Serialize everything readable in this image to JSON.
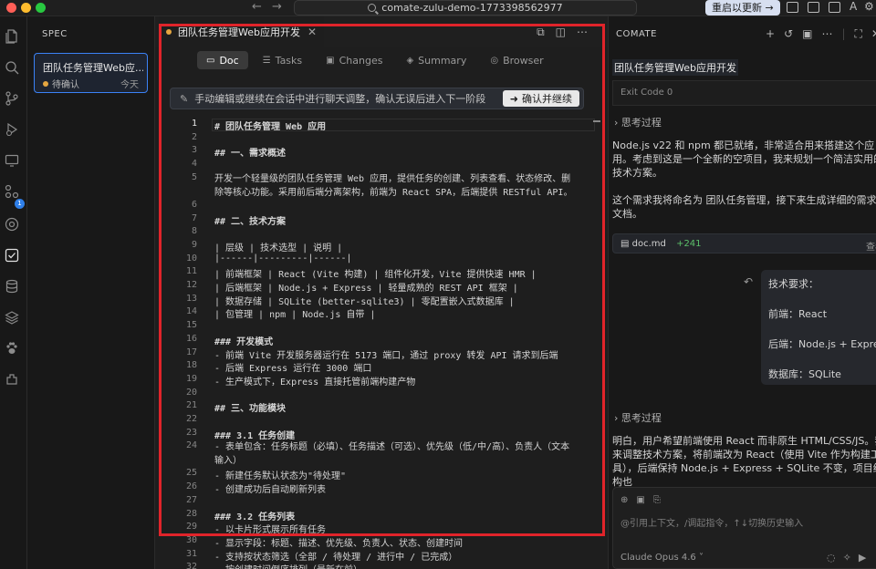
{
  "titlebar": {
    "search_text": "comate-zulu-demo-1773398562977",
    "update_label": "重启以更新 →",
    "back_arrow": "←",
    "forward_arrow": "→",
    "colors": {
      "close": "#ff5f57",
      "minimize": "#febc2e",
      "zoom": "#28c840"
    },
    "right_icons": [
      "layout-sidebar-icon",
      "layout-panel-icon",
      "layout-right-icon",
      "text-size-icon",
      "settings-icon"
    ]
  },
  "activitybar": {
    "icons": [
      "explorer-icon",
      "search-icon",
      "source-control-icon",
      "run-debug-icon",
      "remote-icon",
      "extensions-icon",
      "browser-icon",
      "spec-icon",
      "database-icon",
      "layers-icon",
      "paw-icon",
      "plugin-icon"
    ],
    "badge": "1"
  },
  "spec": {
    "title": "SPEC",
    "card": {
      "title": "团队任务管理Web应...",
      "status": "待确认",
      "time": "今天"
    }
  },
  "editor": {
    "tab_title": "团队任务管理Web应用开发",
    "tab_close": "✕",
    "view_tabs": [
      {
        "label": "Doc",
        "icon": "doc-icon",
        "glyph": "▭"
      },
      {
        "label": "Tasks",
        "icon": "tasks-icon",
        "glyph": "☰"
      },
      {
        "label": "Changes",
        "icon": "changes-icon",
        "glyph": "▣"
      },
      {
        "label": "Summary",
        "icon": "summary-icon",
        "glyph": "◈"
      },
      {
        "label": "Browser",
        "icon": "browser-icon",
        "glyph": "◎"
      }
    ],
    "notice": "手动编辑或继续在会话中进行聊天调整，确认无误后进入下一阶段",
    "confirm_label": "确认并继续",
    "lines": [
      {
        "n": "1",
        "t": "# 团队任务管理 Web 应用"
      },
      {
        "n": "2",
        "t": ""
      },
      {
        "n": "3",
        "t": "## 一、需求概述"
      },
      {
        "n": "4",
        "t": ""
      },
      {
        "n": "5",
        "t": "开发一个轻量级的团队任务管理 Web 应用，提供任务的创建、列表查看、状态修改、删除等核心功能。采用前后端分离架构，前端为 React SPA，后端提供 RESTful API。",
        "wrap": true
      },
      {
        "n": "6",
        "t": ""
      },
      {
        "n": "7",
        "t": "## 二、技术方案"
      },
      {
        "n": "8",
        "t": ""
      },
      {
        "n": "9",
        "t": "| 层级 | 技术选型 | 说明 |"
      },
      {
        "n": "10",
        "t": "|------|---------|------|"
      },
      {
        "n": "11",
        "t": "| 前端框架 | React (Vite 构建) | 组件化开发，Vite 提供快速 HMR |"
      },
      {
        "n": "12",
        "t": "| 后端框架 | Node.js + Express | 轻量成熟的 REST API 框架 |"
      },
      {
        "n": "13",
        "t": "| 数据存储 | SQLite (better-sqlite3) | 零配置嵌入式数据库 |"
      },
      {
        "n": "14",
        "t": "| 包管理 | npm | Node.js 自带 |"
      },
      {
        "n": "15",
        "t": ""
      },
      {
        "n": "16",
        "t": "### 开发模式"
      },
      {
        "n": "17",
        "t": "- 前端 Vite 开发服务器运行在 5173 端口，通过 proxy 转发 API 请求到后端"
      },
      {
        "n": "18",
        "t": "- 后端 Express 运行在 3000 端口"
      },
      {
        "n": "19",
        "t": "- 生产模式下，Express 直接托管前端构建产物"
      },
      {
        "n": "20",
        "t": ""
      },
      {
        "n": "21",
        "t": "## 三、功能模块"
      },
      {
        "n": "22",
        "t": ""
      },
      {
        "n": "23",
        "t": "### 3.1 任务创建"
      },
      {
        "n": "24",
        "t": "- 表单包含：任务标题（必填）、任务描述（可选）、优先级（低/中/高）、负责人（文本输入）",
        "wrap": true
      },
      {
        "n": "25",
        "t": "- 新建任务默认状态为\"待处理\""
      },
      {
        "n": "26",
        "t": "- 创建成功后自动刷新列表"
      },
      {
        "n": "27",
        "t": ""
      },
      {
        "n": "28",
        "t": "### 3.2 任务列表"
      },
      {
        "n": "29",
        "t": "- 以卡片形式展示所有任务"
      },
      {
        "n": "30",
        "t": "- 显示字段：标题、描述、优先级、负责人、状态、创建时间"
      },
      {
        "n": "31",
        "t": "- 支持按状态筛选（全部 / 待处理 / 进行中 / 已完成）"
      },
      {
        "n": "32",
        "t": "- 按创建时间倒序排列（最新在前）"
      }
    ]
  },
  "chat": {
    "title": "COMATE",
    "session_title": "团队任务管理Web应用开发",
    "exit_code": "Exit Code 0",
    "think_label": "思考过程",
    "para1": "Node.js v22 和 npm 都已就绪，非常适合用来搭建这个应用。考虑到这是一个全新的空项目，我来规划一个简洁实用的技术方案。",
    "para2": "这个需求我将命名为 团队任务管理，接下来生成详细的需求文档。",
    "file": {
      "name": "doc.md",
      "added": "+241",
      "view": "查看"
    },
    "bubble": {
      "l1": "技术要求：",
      "l2": "前端：React",
      "l3": "后端：Node.js + Express",
      "l4": "数据库：SQLite"
    },
    "think_label2": "思考过程",
    "para3": "明白，用户希望前端使用 React 而非原生 HTML/CSS/JS。我来调整技术方案，将前端改为 React（使用 Vite 作为构建工具），后端保持 Node.js + Express + SQLite 不变，项目结构也",
    "input_placeholder": "@引用上下文，/调起指令，↑↓切换历史输入",
    "model": "Claude Opus 4.6"
  }
}
